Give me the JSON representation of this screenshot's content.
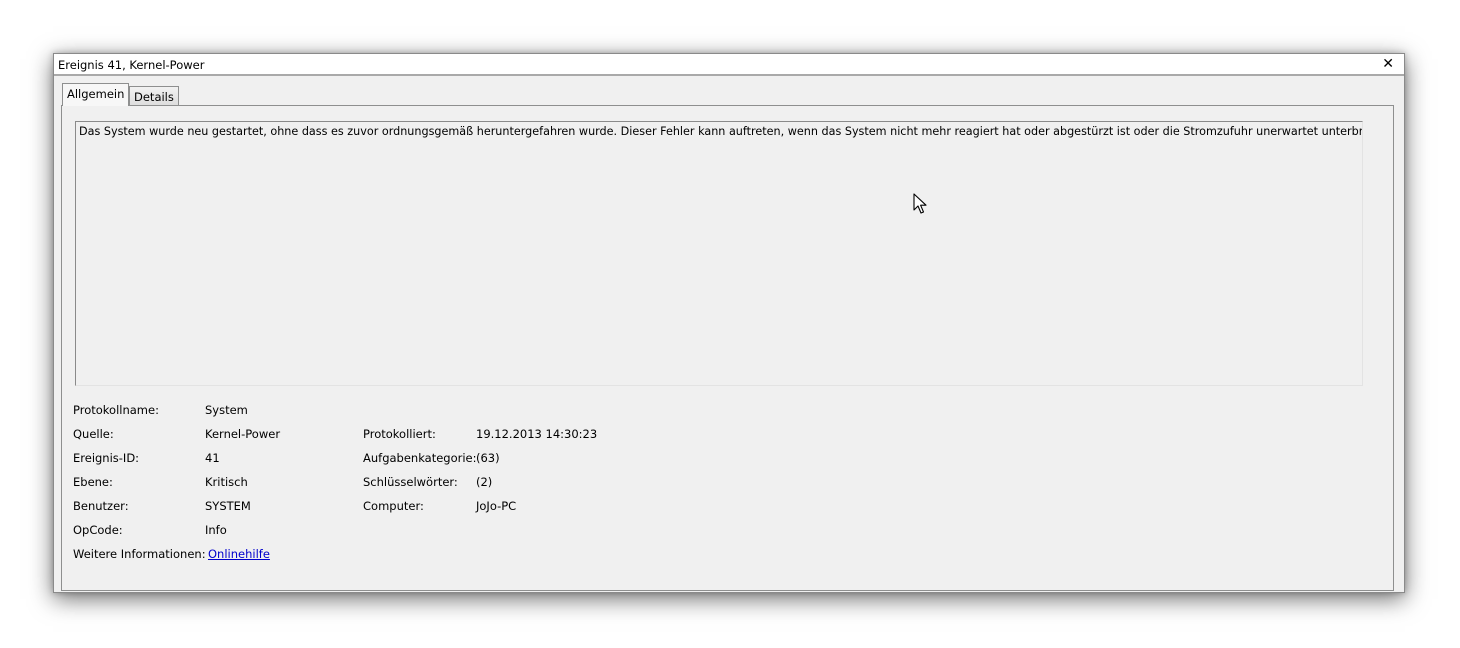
{
  "window": {
    "title": "Ereignis 41, Kernel-Power"
  },
  "tabs": [
    {
      "label": "Allgemein",
      "active": true
    },
    {
      "label": "Details",
      "active": false
    }
  ],
  "description": "Das System wurde neu gestartet, ohne dass es zuvor ordnungsgemäß heruntergefahren wurde. Dieser Fehler kann auftreten, wenn das System nicht mehr reagiert hat oder abgestürzt ist oder die Stromzufuhr unerwartet unterbrochen wurde.",
  "fields": {
    "protokollname": {
      "label": "Protokollname:",
      "value": "System"
    },
    "quelle": {
      "label": "Quelle:",
      "value": "Kernel-Power"
    },
    "ereignis_id": {
      "label": "Ereignis-ID:",
      "value": "41"
    },
    "ebene": {
      "label": "Ebene:",
      "value": "Kritisch"
    },
    "benutzer": {
      "label": "Benutzer:",
      "value": "SYSTEM"
    },
    "opcode": {
      "label": "OpCode:",
      "value": "Info"
    },
    "weitere": {
      "label": "Weitere Informationen:",
      "value": "Onlinehilfe"
    },
    "protokolliert": {
      "label": "Protokolliert:",
      "value": "19.12.2013 14:30:23"
    },
    "aufgabenkategorie": {
      "label": "Aufgabenkategorie:",
      "value": "(63)"
    },
    "schluesselwoerter": {
      "label": "Schlüsselwörter:",
      "value": "(2)"
    },
    "computer": {
      "label": "Computer:",
      "value": "JoJo-PC"
    }
  },
  "icons": {
    "close": "close-icon",
    "cursor": "mouse-cursor-icon"
  }
}
